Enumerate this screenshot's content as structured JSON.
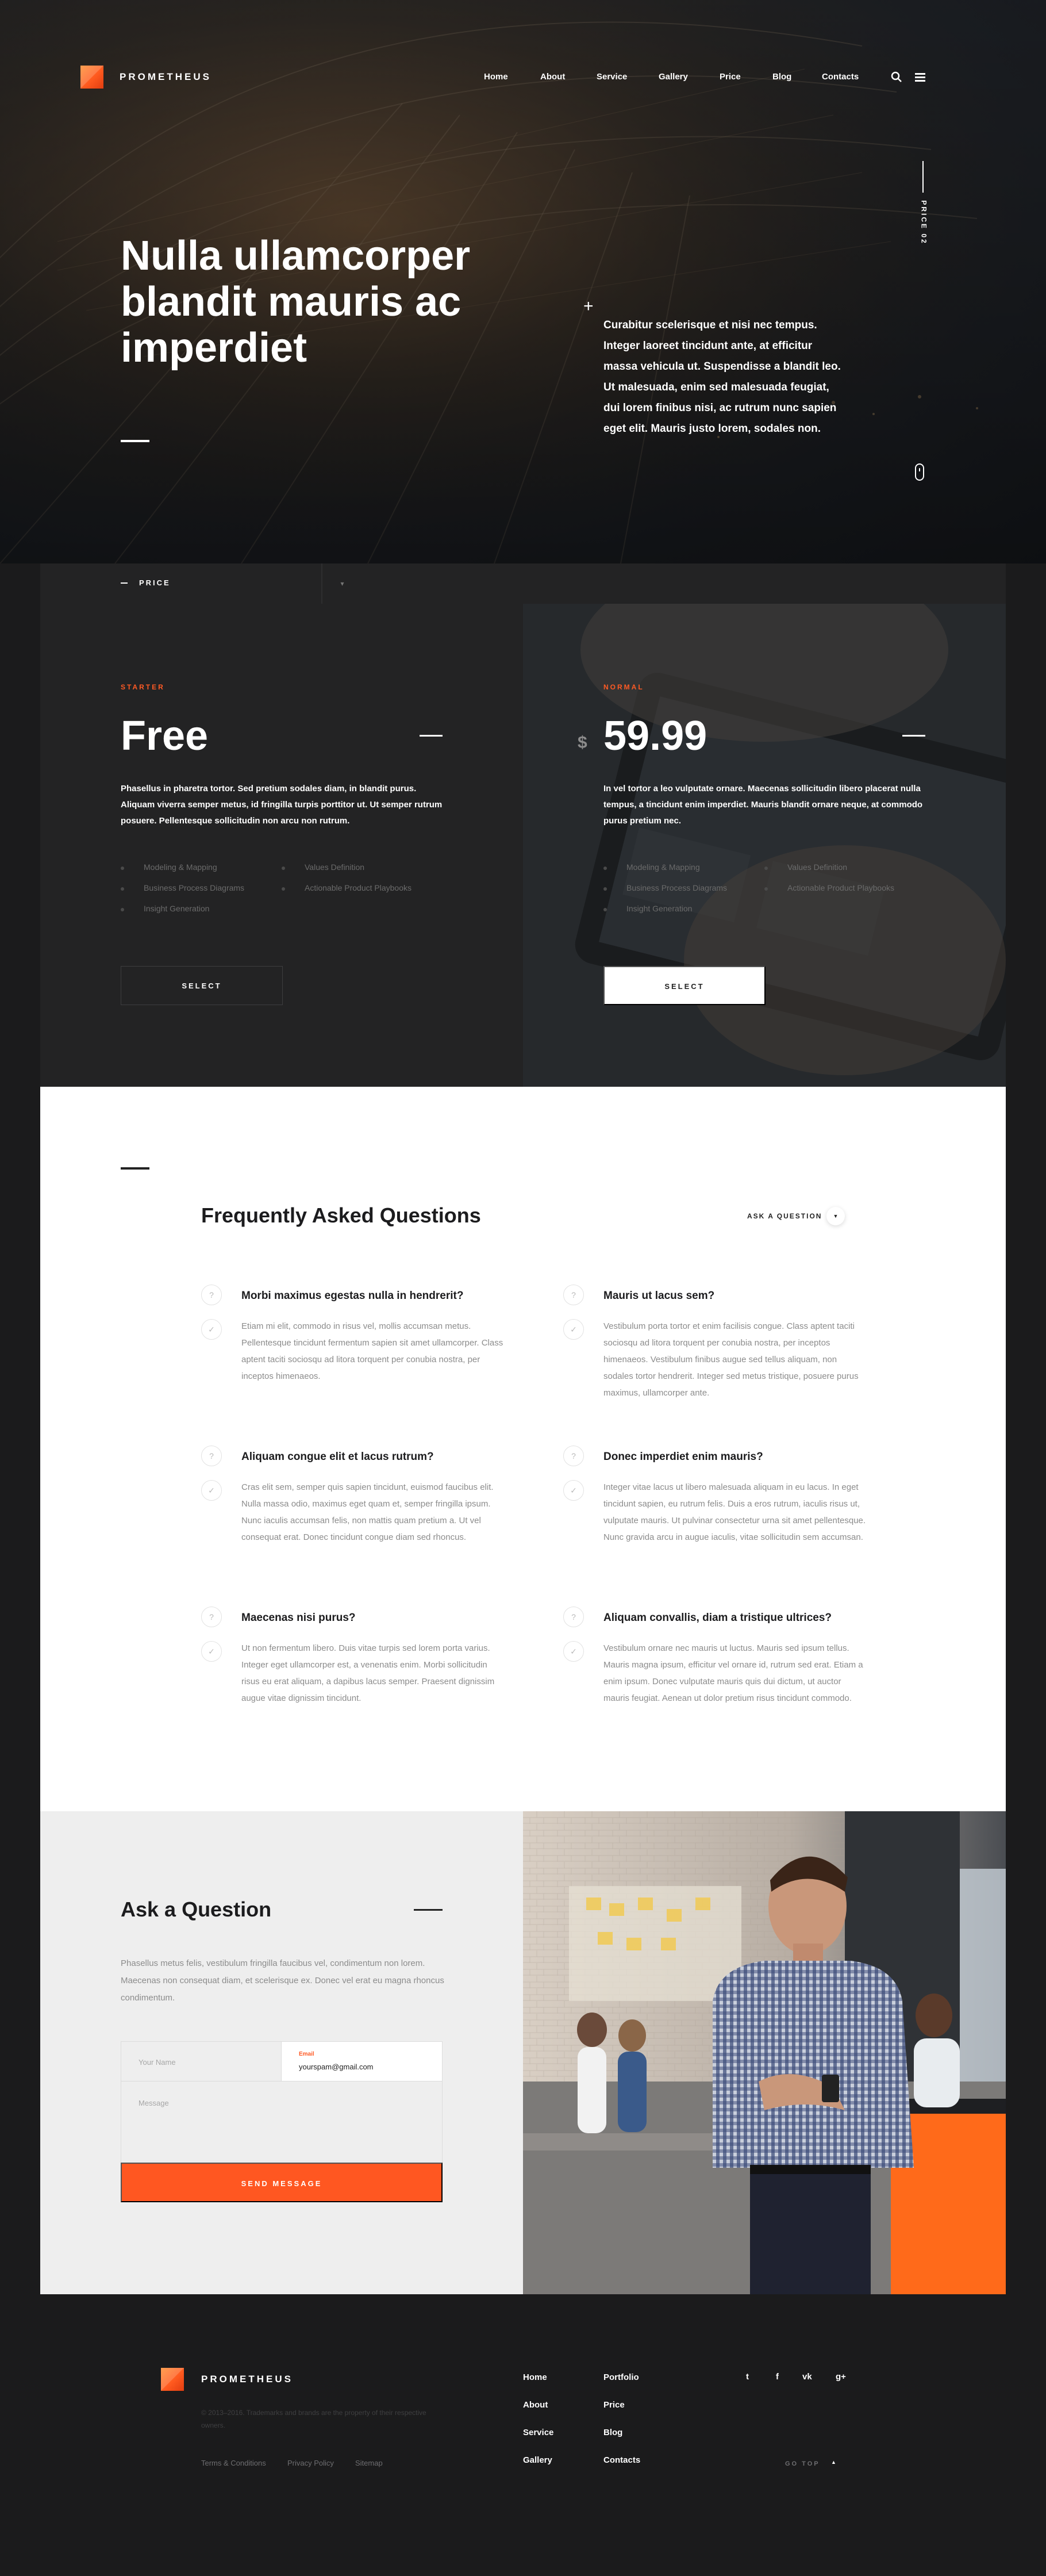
{
  "brand": {
    "name": "PROMETHEUS"
  },
  "nav": {
    "items": [
      "Home",
      "About",
      "Service",
      "Gallery",
      "Price",
      "Blog",
      "Contacts"
    ]
  },
  "hero": {
    "title_lines": [
      "Nulla ullamcorper",
      "blandit mauris ac",
      "imperdiet"
    ],
    "description": "Curabitur scelerisque et nisi nec tempus. Integer laoreet tincidunt ante, at efficitur massa vehicula ut. Suspendisse a blandit leo. Ut malesuada, enim sed malesuada feugiat, dui lorem finibus nisi, ac rutrum nunc sapien eget elit. Mauris justo lorem, sodales non.",
    "side_label": "PRICE 02"
  },
  "price_bar": {
    "label": "PRICE"
  },
  "plans": [
    {
      "kicker": "STARTER",
      "price": "Free",
      "currency": "",
      "description": "Phasellus in pharetra tortor. Sed pretium sodales diam, in blandit purus. Aliquam viverra semper metus, id fringilla turpis porttitor ut. Ut semper rutrum posuere. Pellentesque sollicitudin non arcu non rutrum.",
      "features": [
        "Modeling & Mapping",
        "Values Definition",
        "Business Process Diagrams",
        "Actionable Product Playbooks",
        "Insight Generation"
      ],
      "button": "SELECT"
    },
    {
      "kicker": "NORMAL",
      "price": "59.99",
      "currency": "$",
      "description": "In vel tortor a leo vulputate ornare. Maecenas sollicitudin libero placerat nulla tempus, a tincidunt enim imperdiet. Mauris blandit ornare neque, at commodo purus pretium nec.",
      "features": [
        "Modeling & Mapping",
        "Values Definition",
        "Business Process Diagrams",
        "Actionable Product Playbooks",
        "Insight Generation"
      ],
      "button": "SELECT"
    }
  ],
  "faq": {
    "title": "Frequently Asked Questions",
    "ask_link": "ASK A QUESTION",
    "items": [
      {
        "q": "Morbi maximus egestas nulla in hendrerit?",
        "a": "Etiam mi elit, commodo in risus vel, mollis accumsan metus. Pellentesque tincidunt fermentum sapien sit amet ullamcorper. Class aptent taciti sociosqu ad litora torquent per conubia nostra, per inceptos himenaeos."
      },
      {
        "q": "Mauris ut lacus sem?",
        "a": "Vestibulum porta tortor et enim facilisis congue. Class aptent taciti sociosqu ad litora torquent per conubia nostra, per inceptos himenaeos. Vestibulum finibus augue sed tellus aliquam, non sodales tortor hendrerit. Integer sed metus tristique, posuere purus maximus, ullamcorper ante."
      },
      {
        "q": "Aliquam congue elit et lacus rutrum?",
        "a": "Cras elit sem, semper quis sapien tincidunt, euismod faucibus elit. Nulla massa odio, maximus eget quam et, semper fringilla ipsum. Nunc iaculis accumsan felis, non mattis quam pretium a. Ut vel consequat erat. Donec tincidunt congue diam sed rhoncus."
      },
      {
        "q": "Donec imperdiet enim mauris?",
        "a": "Integer vitae lacus ut libero malesuada aliquam in eu lacus. In eget tincidunt sapien, eu rutrum felis. Duis a eros rutrum, iaculis risus ut, vulputate mauris. Ut pulvinar consectetur urna sit amet pellentesque. Nunc gravida arcu in augue iaculis, vitae sollicitudin sem accumsan."
      },
      {
        "q": "Maecenas nisi purus?",
        "a": "Ut non fermentum libero. Duis vitae turpis sed lorem porta varius. Integer eget ullamcorper est, a venenatis enim. Morbi sollicitudin risus eu erat aliquam, a dapibus lacus semper. Praesent dignissim augue vitae dignissim tincidunt."
      },
      {
        "q": "Aliquam convallis, diam a tristique ultrices?",
        "a": "Vestibulum ornare nec mauris ut luctus. Mauris sed ipsum tellus. Mauris magna ipsum, efficitur vel ornare id, rutrum sed erat. Etiam a enim ipsum. Donec vulputate mauris quis dui dictum, ut auctor mauris feugiat. Aenean ut dolor pretium risus tincidunt commodo."
      }
    ]
  },
  "ask": {
    "title": "Ask a Question",
    "description": "Phasellus metus felis, vestibulum fringilla faucibus vel, condimentum non lorem. Maecenas non consequat diam, et scelerisque ex. Donec vel erat eu magna rhoncus condimentum.",
    "name_placeholder": "Your Name",
    "email_label": "Email",
    "email_value": "yourspam@gmail.com",
    "message_placeholder": "Message",
    "send": "SEND MESSAGE"
  },
  "footer": {
    "brand": "PROMETHEUS",
    "copyright": "© 2013–2016. Trademarks and brands are the property of their respective owners.",
    "legal": [
      "Terms & Conditions",
      "Privacy Policy",
      "Sitemap"
    ],
    "col1": [
      "Home",
      "About",
      "Service",
      "Gallery"
    ],
    "col2": [
      "Portfolio",
      "Price",
      "Blog",
      "Contacts"
    ],
    "social": [
      "twitter-icon",
      "facebook-icon",
      "vk-icon",
      "google-plus-icon"
    ],
    "social_glyphs": [
      "t",
      "f",
      "vk",
      "g+"
    ],
    "go_top": "GO TOP"
  },
  "colors": {
    "accent": "#ff5721",
    "dark": "#1b1b1c",
    "panel": "#232324",
    "light": "#eeeeee"
  }
}
